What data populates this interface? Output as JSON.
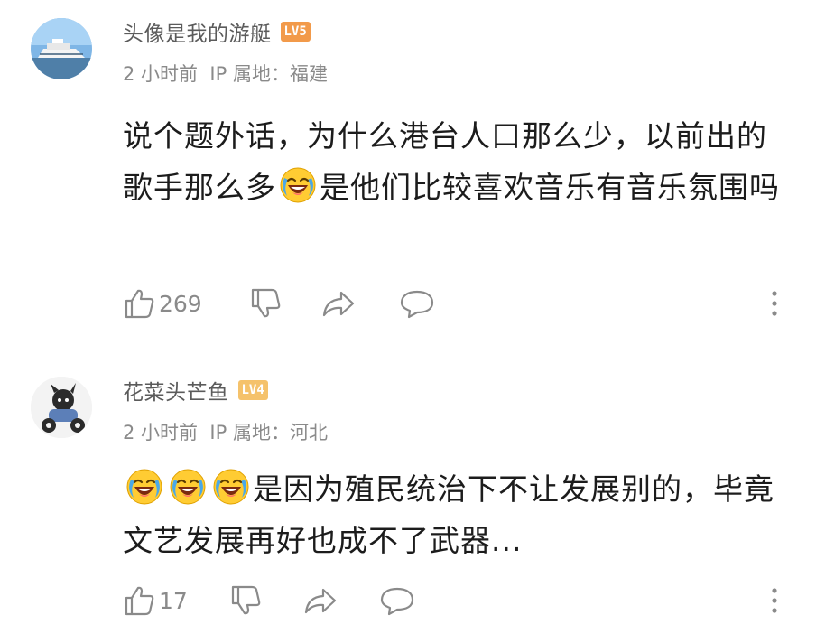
{
  "comments": [
    {
      "username": "头像是我的游艇",
      "level": "LV5",
      "time": "2 小时前",
      "ip_location": "IP 属地：福建",
      "text_part1": "说个题外话，为什么港台人口那么少，以前出的歌手那么多",
      "text_part2": "是他们比较喜欢音乐有音乐氛围吗",
      "emoji": "laugh-cry-emoji",
      "likes": "269"
    },
    {
      "username": "花菜头芒鱼",
      "level": "LV4",
      "time": "2 小时前",
      "ip_location": "IP 属地：河北",
      "text_part1": "是因为殖民统治下不让发展别的，毕竟文艺发展再好也成不了武器...",
      "emoji": "laugh-cry-emoji",
      "likes": "17"
    }
  ],
  "icons": {
    "like": "thumbs-up-icon",
    "dislike": "thumbs-down-icon",
    "share": "share-arrow-icon",
    "reply": "speech-bubble-icon",
    "more": "more-vertical-icon"
  },
  "colors": {
    "lv5_badge": "#f29a4a",
    "lv4_badge": "#f5c26b",
    "meta_text": "#8a8a8a",
    "body_text": "#1c1c1c"
  }
}
